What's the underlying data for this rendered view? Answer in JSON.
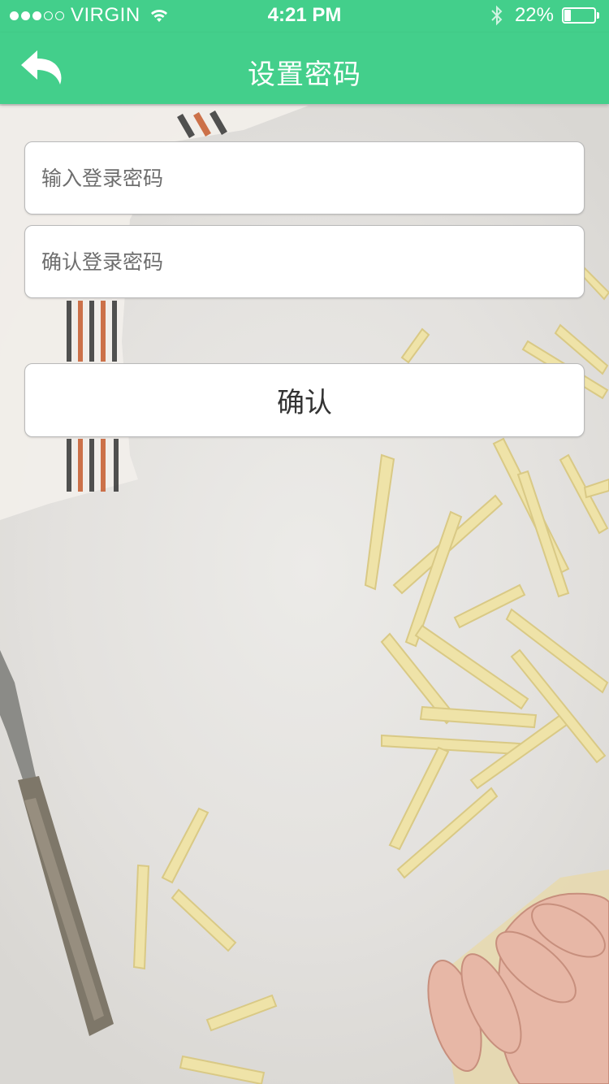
{
  "status_bar": {
    "carrier": "VIRGIN",
    "signal_bars": 3,
    "signal_max": 5,
    "time": "4:21 PM",
    "battery_text": "22%",
    "battery_level": 0.22,
    "icons": [
      "signal-dots",
      "wifi-icon",
      "bluetooth-icon",
      "battery-icon"
    ]
  },
  "navbar": {
    "back_icon": "reply-arrow-icon",
    "title": "设置密码",
    "color": "#43cf8b"
  },
  "form": {
    "password": {
      "value": "",
      "placeholder": "输入登录密码"
    },
    "confirm_password": {
      "value": "",
      "placeholder": "确认登录密码"
    },
    "submit_label": "确认"
  }
}
